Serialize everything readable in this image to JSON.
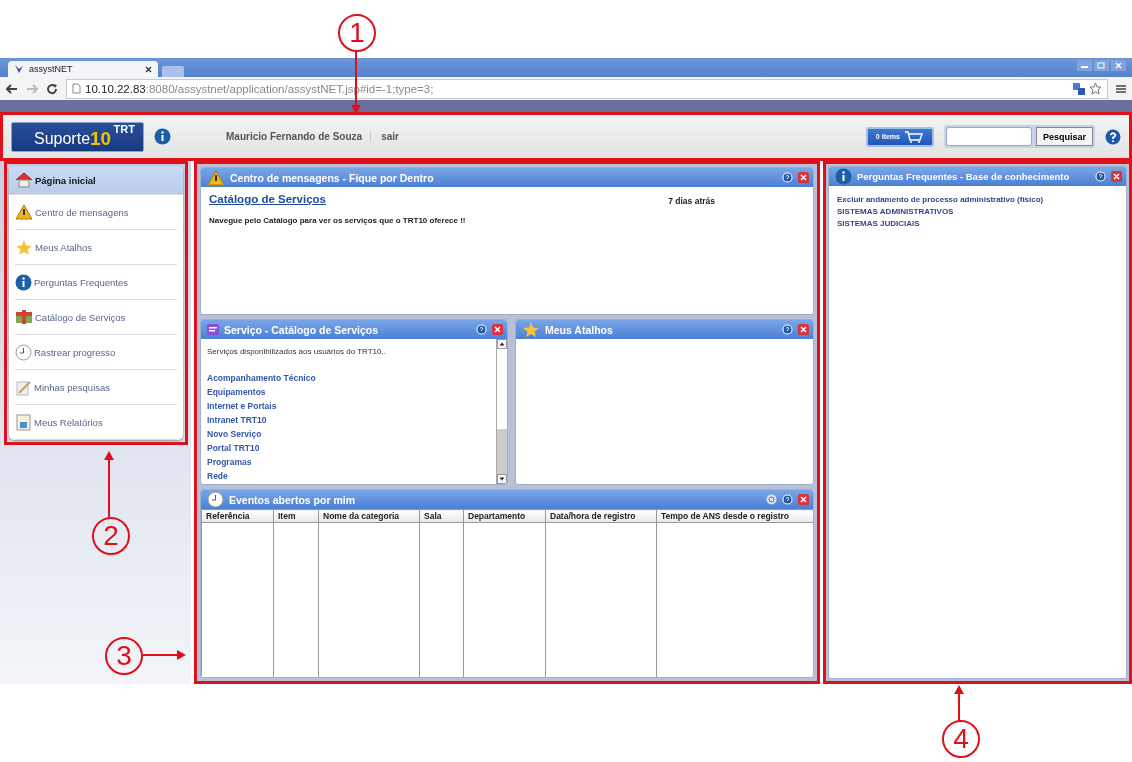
{
  "annotations": [
    {
      "label": "1"
    },
    {
      "label": "2"
    },
    {
      "label": "3"
    },
    {
      "label": "4"
    }
  ],
  "browser": {
    "tab_title": "assystNET",
    "url_host": "10.10.22.83",
    "url_path": ":8080/assystnet/application/assystNET.jsp#id=-1;type=3;"
  },
  "header": {
    "logo_word": "Suporte",
    "logo_org": "TRT",
    "logo_number": "10",
    "user_name": "Mauricio Fernando de Souza",
    "logout": "sair",
    "cart": "0 Items",
    "search_button": "Pesquisar"
  },
  "sidebar": {
    "items": [
      {
        "label": "Página inicial",
        "selected": true,
        "kind": "home"
      },
      {
        "label": "Centro de mensagens",
        "selected": false,
        "kind": "warning"
      },
      {
        "label": "Meus Atalhos",
        "selected": false,
        "kind": "star"
      },
      {
        "label": "Perguntas Frequentes",
        "selected": false,
        "kind": "info"
      },
      {
        "label": "Catálogo de Serviços",
        "selected": false,
        "kind": "catalog"
      },
      {
        "label": "Rastrear progresso",
        "selected": false,
        "kind": "clock"
      },
      {
        "label": "Minhas pesquisas",
        "selected": false,
        "kind": "pencil"
      },
      {
        "label": "Meus Relatórios",
        "selected": false,
        "kind": "report"
      }
    ]
  },
  "messages": {
    "title": "Centro de mensagens - Fique por Dentro",
    "link": "Catálogo de Serviços",
    "age": "7 dias atrás",
    "text": "Navegue pelo Catálogo para ver os serviços que o TRT10 oferece !!"
  },
  "services": {
    "title": "Serviço - Catálogo de Serviços",
    "intro": "Serviços disponibilizados aos usuários do TRT10..",
    "links": [
      "Acompanhamento Técnico",
      "Equipamentos",
      "Internet e Portais",
      "Intranet TRT10",
      "Novo Serviço",
      "Portal TRT10",
      "Programas",
      "Rede"
    ]
  },
  "shortcuts": {
    "title": "Meus Atalhos"
  },
  "events": {
    "title": "Eventos abertos por mim",
    "columns": [
      "Referência",
      "Item",
      "Nome da categoria",
      "Sala",
      "Departamento",
      "Data/hora de registro",
      "Tempo de ANS desde o registro"
    ]
  },
  "faq": {
    "title": "Perguntas Frequentes - Base de conhecimento",
    "items": [
      "Excluir andamento de processo administrativo (físico)",
      "SISTEMAS ADMINISTRATIVOS",
      "SISTEMAS JUDICIAIS"
    ]
  }
}
